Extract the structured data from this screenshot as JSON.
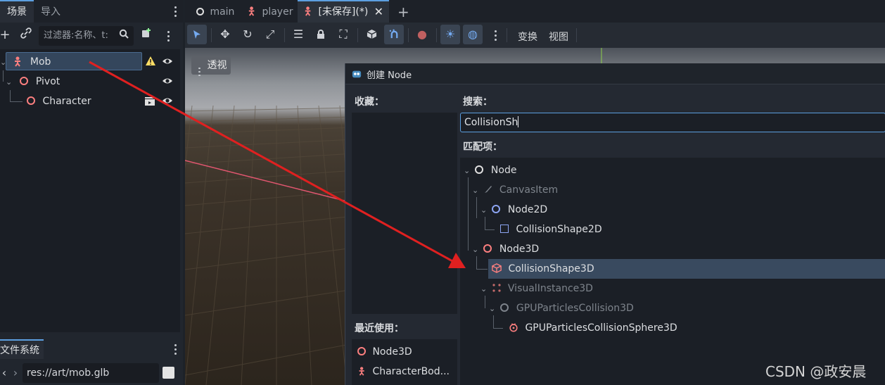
{
  "scene_dock": {
    "tabs": [
      "场景",
      "导入"
    ],
    "filter_placeholder": "过滤器:名称、t:",
    "tree": [
      {
        "label": "Mob",
        "icon": "character-body-icon"
      },
      {
        "label": "Pivot",
        "icon": "node3d-icon"
      },
      {
        "label": "Character",
        "icon": "node3d-icon"
      }
    ]
  },
  "filesystem": {
    "tab": "文件系统",
    "path": "res://art/mob.glb"
  },
  "editor_tabs": [
    {
      "label": "main",
      "icon": "node3d-icon"
    },
    {
      "label": "player",
      "icon": "character-body-icon"
    },
    {
      "label": "[未保存](*)",
      "icon": "character-body-icon",
      "active": true
    }
  ],
  "viewport_toolbar": {
    "menu_transform": "变换",
    "menu_view": "视图"
  },
  "viewport": {
    "perspective_label": "透视"
  },
  "dialog": {
    "title": "创建 Node",
    "favorites_label": "收藏：",
    "recent_label": "最近使用：",
    "search_label": "搜索：",
    "search_value": "CollisionSh",
    "matches_label": "匹配项：",
    "matches": [
      {
        "label": "Node",
        "dim": false
      },
      {
        "label": "CanvasItem",
        "dim": true
      },
      {
        "label": "Node2D",
        "dim": false
      },
      {
        "label": "CollisionShape2D",
        "dim": false
      },
      {
        "label": "Node3D",
        "dim": false
      },
      {
        "label": "CollisionShape3D",
        "dim": false,
        "selected": true
      },
      {
        "label": "VisualInstance3D",
        "dim": true
      },
      {
        "label": "GPUParticlesCollision3D",
        "dim": true
      },
      {
        "label": "GPUParticlesCollisionSphere3D",
        "dim": false
      }
    ],
    "recent": [
      {
        "label": "Node3D"
      },
      {
        "label": "CharacterBod..."
      }
    ]
  },
  "watermark": "CSDN @政安晨",
  "colors": {
    "accent": "#5c9fe0",
    "node3d": "#fc7f7f",
    "node2d": "#8da5f3",
    "arrow": "#e02020"
  }
}
